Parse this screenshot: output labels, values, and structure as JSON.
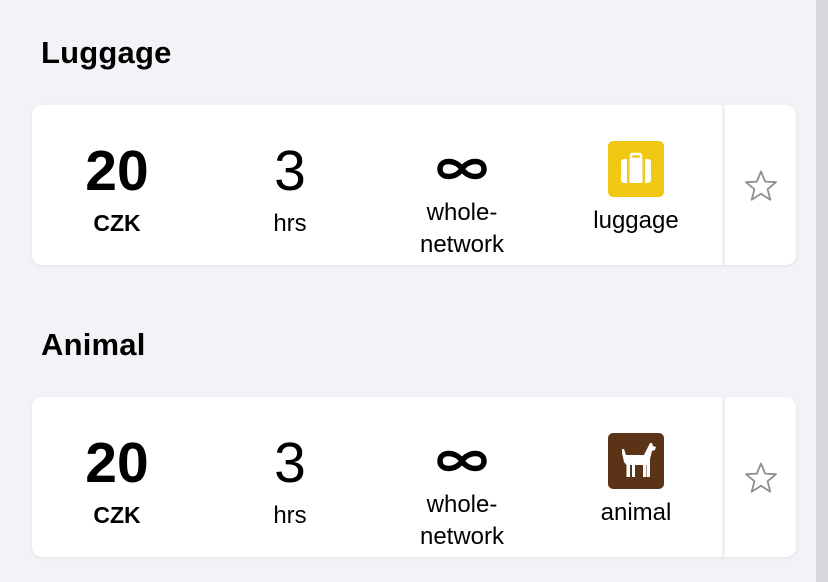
{
  "sections": [
    {
      "title": "Luggage",
      "price_value": "20",
      "price_unit": "CZK",
      "duration_value": "3",
      "duration_unit": "hrs",
      "zone_symbol": "∞",
      "zone_label": "whole-\nnetwork",
      "type_label": "luggage",
      "type_icon": "suitcase-icon",
      "type_color": "#f0c814",
      "favorite_icon": "star-outline-icon"
    },
    {
      "title": "Animal",
      "price_value": "20",
      "price_unit": "CZK",
      "duration_value": "3",
      "duration_unit": "hrs",
      "zone_symbol": "∞",
      "zone_label": "whole-\nnetwork",
      "type_label": "animal",
      "type_icon": "dog-icon",
      "type_color": "#5b3317",
      "favorite_icon": "star-outline-icon"
    }
  ],
  "colors": {
    "background": "#f2f2f7",
    "card": "#ffffff",
    "star_stroke": "#8e8e93"
  }
}
